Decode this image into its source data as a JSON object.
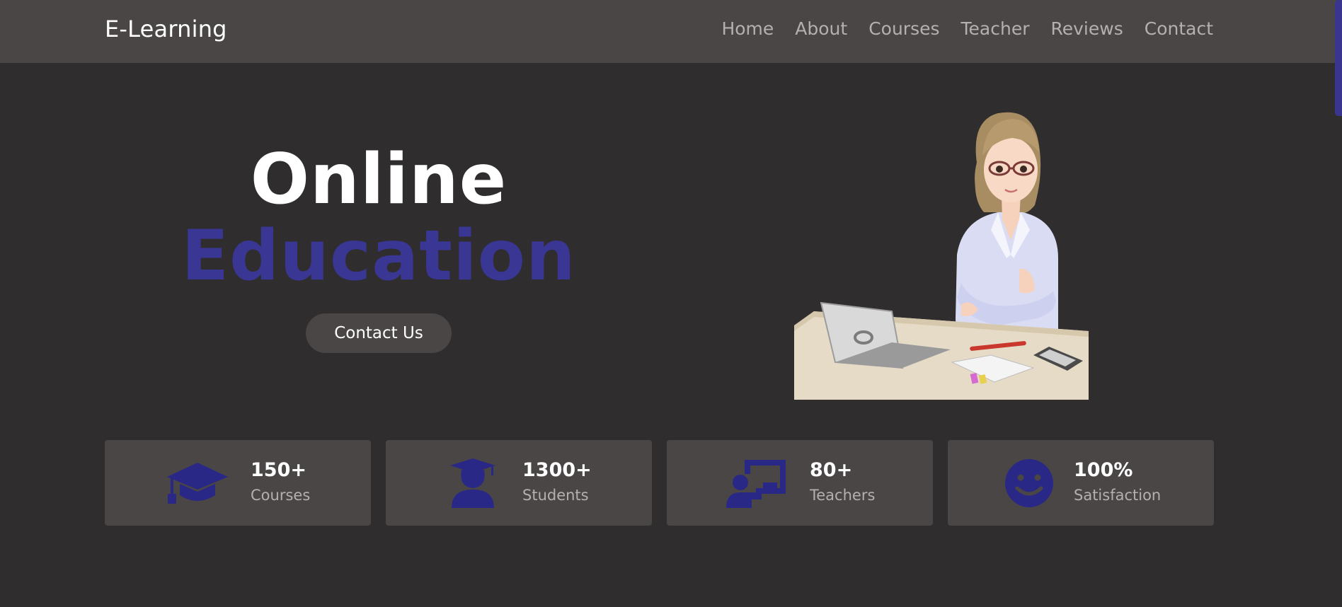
{
  "header": {
    "logo": "E-Learning",
    "nav": [
      "Home",
      "About",
      "Courses",
      "Teacher",
      "Reviews",
      "Contact"
    ]
  },
  "hero": {
    "title_line1": "Online",
    "title_line2": "Education",
    "contact_button": "Contact Us",
    "illustration": "teacher-at-desk-illustration"
  },
  "stats": [
    {
      "value": "150+",
      "label": "Courses",
      "icon": "graduation-cap-icon"
    },
    {
      "value": "1300+",
      "label": "Students",
      "icon": "graduate-student-icon"
    },
    {
      "value": "80+",
      "label": "Teachers",
      "icon": "teacher-board-icon"
    },
    {
      "value": "100%",
      "label": "Satisfaction",
      "icon": "smile-icon"
    }
  ],
  "colors": {
    "background": "#2f2d2e",
    "header": "#4a4646",
    "accent": "#3a3693",
    "icon": "#2a2886",
    "muted_text": "#b4b0b0"
  }
}
